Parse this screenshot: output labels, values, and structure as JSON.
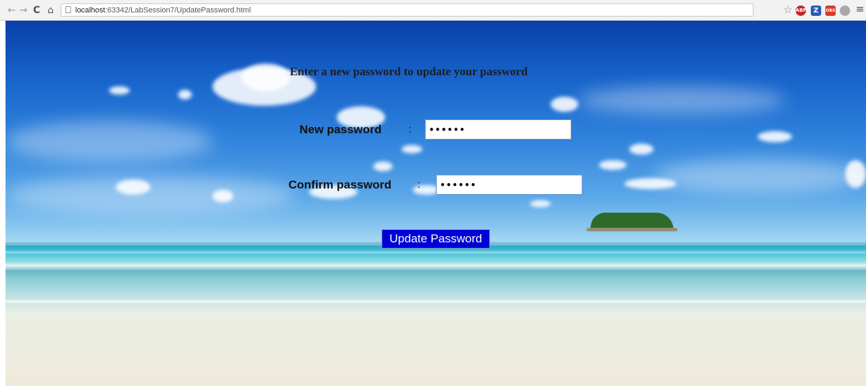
{
  "browser": {
    "url_host": "localhost",
    "url_rest": ":63342/LabSession7/UpdatePassword.html",
    "ext_badges": {
      "abp": "ABP",
      "z": "Z",
      "red": "OBS"
    }
  },
  "form": {
    "heading": "Enter a new password to update your password",
    "new_password_label": "New password",
    "new_password_colon": ":",
    "new_password_value": "123456",
    "confirm_password_label": "Confirm password",
    "confirm_password_colon": ":",
    "confirm_password_value": "123456",
    "submit_label": "Update Password"
  },
  "colors": {
    "button_background": "#0000d6",
    "button_text": "#ffffff"
  },
  "icons": [
    "back-arrow-icon",
    "forward-arrow-icon",
    "reload-icon",
    "home-icon",
    "page-icon",
    "bookmark-star-icon",
    "adblock-icon",
    "zotero-icon",
    "extension-icon",
    "extension-gray-icon",
    "menu-icon"
  ]
}
